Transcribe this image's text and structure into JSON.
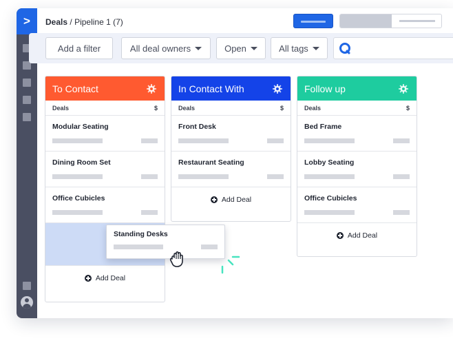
{
  "colors": {
    "accent": "#1f66e5",
    "rail": "#4a4f62",
    "to_contact": "#ff5a30",
    "in_contact_with": "#1443e8",
    "follow_up": "#1ecc9f",
    "drop_zone": "#cddbf6"
  },
  "nav": {
    "logo_glyph": ">"
  },
  "header": {
    "title": "Deals",
    "separator": "/",
    "pipeline": "Pipeline 1 (7)"
  },
  "filters": {
    "add_filter": "Add a filter",
    "owners": "All deal owners",
    "status": "Open",
    "tags": "All tags"
  },
  "columns": [
    {
      "title": "To Contact",
      "sub_left": "Deals",
      "sub_right": "$",
      "cards": [
        "Modular Seating",
        "Dining Room Set",
        "Office Cubicles"
      ],
      "add_label": "Add Deal"
    },
    {
      "title": "In Contact With",
      "sub_left": "Deals",
      "sub_right": "$",
      "cards": [
        "Front Desk",
        "Restaurant Seating"
      ],
      "add_label": "Add Deal"
    },
    {
      "title": "Follow up",
      "sub_left": "Deals",
      "sub_right": "$",
      "cards": [
        "Bed Frame",
        "Lobby Seating",
        "Office Cubicles"
      ],
      "add_label": "Add Deal"
    }
  ],
  "dragging_card": {
    "title": "Standing Desks"
  },
  "icons": {
    "logo": "chevron-right-icon",
    "search": "search-icon",
    "column_settings": "gear-icon",
    "add": "plus-circle-icon",
    "cursor": "grab-hand-icon",
    "avatar": "user-avatar-icon"
  }
}
